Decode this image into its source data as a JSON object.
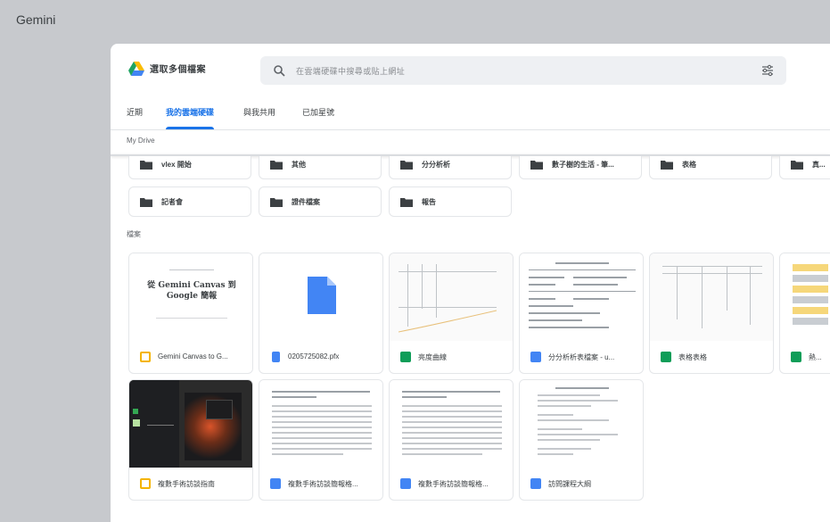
{
  "app": {
    "title": "Gemini"
  },
  "picker": {
    "title": "選取多個檔案",
    "search_placeholder": "在雲端硬碟中搜尋或貼上網址",
    "icons": {
      "logo": "google-drive-logo",
      "search": "search-icon",
      "filter": "filter-icon"
    }
  },
  "tabs": [
    {
      "label": "近期",
      "active": false
    },
    {
      "label": "我的雲端硬碟",
      "active": true
    },
    {
      "label": "與我共用",
      "active": false
    },
    {
      "label": "已加星號",
      "active": false
    }
  ],
  "breadcrumb": "My Drive",
  "folders": [
    {
      "name": "vlex 開始"
    },
    {
      "name": "其他"
    },
    {
      "name": "分分析析"
    },
    {
      "name": "數子樹的生活 - 筆..."
    },
    {
      "name": "表格"
    },
    {
      "name": "真..."
    },
    {
      "name": "記者會"
    },
    {
      "name": "證件檔案"
    },
    {
      "name": "報告"
    }
  ],
  "files_label": "檔案",
  "files": [
    {
      "name": "Gemini Canvas to G...",
      "type": "slides",
      "thumb_title": "從 Gemini Canvas 到 Google 簡報"
    },
    {
      "name": "0205725082.pfx",
      "type": "doc-blue"
    },
    {
      "name": "亮度曲線",
      "type": "sheets"
    },
    {
      "name": "分分析析表檔案 - u...",
      "type": "docs"
    },
    {
      "name": "表格表格",
      "type": "sheets"
    },
    {
      "name": "熱...",
      "type": "sheets"
    },
    {
      "name": "複數手術訪談指南",
      "type": "slides"
    },
    {
      "name": "複數手術訪談簡報格...",
      "type": "docs"
    },
    {
      "name": "複數手術訪談簡報格...",
      "type": "docs"
    },
    {
      "name": "訪問課程大綱",
      "type": "docs"
    }
  ],
  "colors": {
    "accent": "#1a73e8",
    "slides": "#f4b400",
    "sheets": "#0f9d58",
    "docs": "#4285f4",
    "folder": "#3c4043"
  }
}
